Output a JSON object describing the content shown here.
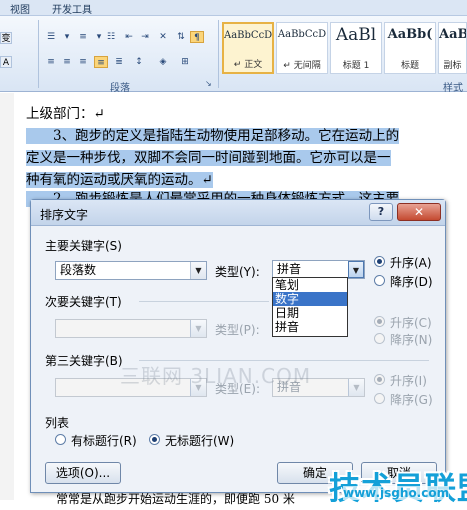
{
  "ribbon": {
    "tabs": [
      "视图",
      "开发工具"
    ],
    "paragraph_group_label": "段落",
    "styles_group_label": "样式",
    "styles": [
      {
        "sample": "AaBbCcD",
        "name": "↵ 正文",
        "selected": true
      },
      {
        "sample": "AaBbCcD",
        "name": "↵ 无间隔",
        "selected": false
      },
      {
        "sample": "AaBl",
        "name": "标题 1",
        "selected": false
      },
      {
        "sample": "AaBb(",
        "name": "标题",
        "selected": false
      },
      {
        "sample": "AaBb",
        "name": "副标",
        "selected": false
      }
    ],
    "left_stubs": [
      "变",
      "A"
    ]
  },
  "document": {
    "lines": [
      {
        "text": "上级部门：↵",
        "highlight": false
      },
      {
        "text": "　　3、跑步的定义是指陆生动物使用足部移动。它在运动上的",
        "highlight": true
      },
      {
        "text": "定义是一种步伐，双脚不会同一时间踫到地面。它亦可以是一",
        "highlight": true
      },
      {
        "text": "种有氧的运动或厌氧的运动。↵",
        "highlight": true
      },
      {
        "text": "　　2、跑步锻炼是人们最常采用的一种身体锻炼方式，这主要",
        "highlight": true
      }
    ],
    "bottom_line": "常常是从跑步开始运动生涯的，即便跑 50 米"
  },
  "dialog": {
    "title": "排序文字",
    "help": "?",
    "close": "✕",
    "primary_key": {
      "label": "主要关键字(S)",
      "field": "段落数",
      "type_label": "类型(Y):",
      "type_value": "拼音",
      "asc_label": "升序(A)",
      "desc_label": "降序(D)"
    },
    "type_dropdown_options": [
      "笔划",
      "数字",
      "日期",
      "拼音"
    ],
    "type_dropdown_selected": 1,
    "secondary_key": {
      "label": "次要关键字(T)",
      "field": "",
      "type_label": "类型(P):",
      "type_value": "",
      "asc_label": "升序(C)",
      "desc_label": "降序(N)"
    },
    "tertiary_key": {
      "label": "第三关键字(B)",
      "field": "",
      "type_label": "类型(E):",
      "type_value": "拼音",
      "asc_label": "升序(I)",
      "desc_label": "降序(G)"
    },
    "list": {
      "label": "列表",
      "header_row": "有标题行(R)",
      "no_header_row": "无标题行(W)"
    },
    "options_button": "选项(O)...",
    "ok_button": "确定",
    "cancel_button": "取消"
  },
  "watermarks": {
    "center": "三联网 3LIAN.COM",
    "brand": "技术员联盟",
    "brand_url": "www.jsgho.com"
  },
  "colors": {
    "highlight": "#a9c9ec",
    "dropdown_selected": "#3a74c8",
    "brand": "#14a0d8"
  }
}
